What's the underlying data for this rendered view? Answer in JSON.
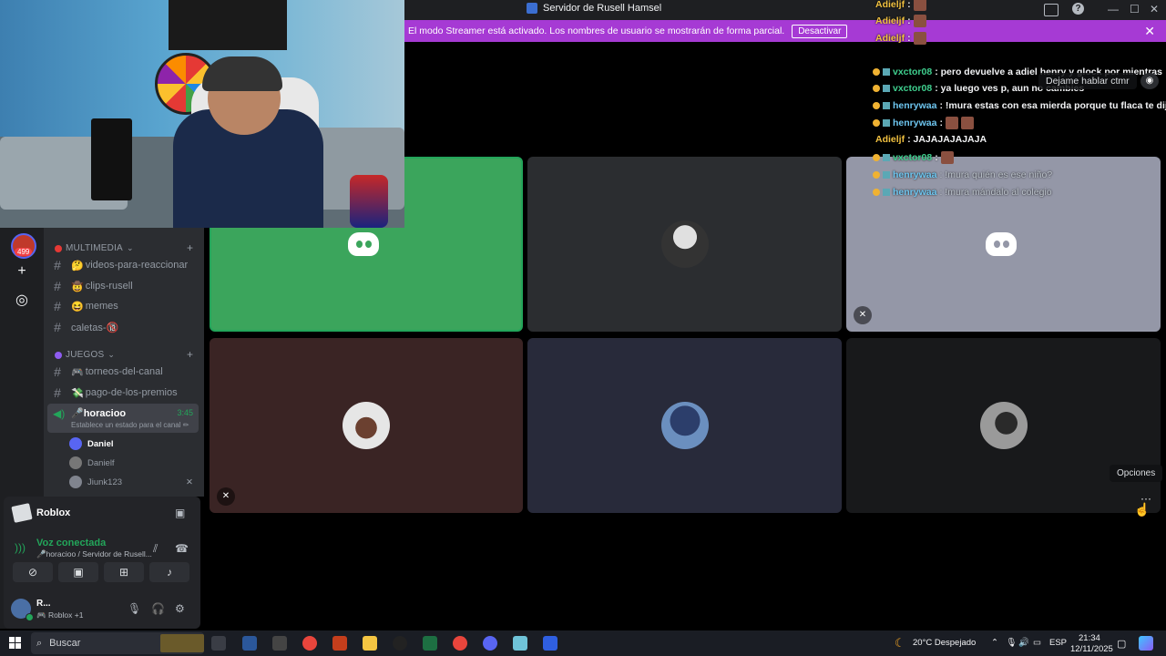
{
  "titlebar": {
    "title": "Servidor de Rusell Hamsel",
    "minimize": "—",
    "maximize": "☐",
    "close": "✕"
  },
  "banner": {
    "text": "El modo Streamer está activado. Los nombres de usuario se mostrarán de forma parcial.",
    "button": "Desactivar",
    "close": "✕"
  },
  "rail": {
    "badge": "499",
    "add": "+",
    "explore": "◎"
  },
  "channels": {
    "cat1": "MULTIMEDIA",
    "cat1_items": [
      {
        "emoji": "🤔",
        "name": "videos-para-reaccionar"
      },
      {
        "emoji": "🤠",
        "name": "clips-rusell"
      },
      {
        "emoji": "😆",
        "name": "memes"
      },
      {
        "emoji": "",
        "name": "caletas-🔞"
      }
    ],
    "cat2": "JUEGOS",
    "cat2_items": [
      {
        "emoji": "🎮",
        "name": "torneos-del-canal"
      },
      {
        "emoji": "💸",
        "name": "pago-de-los-premios"
      }
    ],
    "voice": {
      "name": "🎤horacioo",
      "time": "3:45",
      "status": "Establece un estado para el canal ✏"
    },
    "members": [
      "Daniel",
      "Danielf",
      "Jiunk123"
    ]
  },
  "panel": {
    "activity": "Roblox",
    "voice_status": "Voz conectada",
    "voice_sub": "🎤horacioo / Servidor de Rusell...",
    "user_name": "R...",
    "user_sub": "🎮 Roblox +1"
  },
  "chat": [
    {
      "user": "Adieljf",
      "text": ":",
      "color": "orange",
      "badges": false,
      "emote": true
    },
    {
      "user": "Adieljf",
      "text": ":",
      "color": "orange",
      "badges": false,
      "emote": true
    },
    {
      "user": "Adieljf",
      "text": ":",
      "color": "orange",
      "badges": false,
      "emote": true
    },
    {
      "user": "vxctor08",
      "text": ": pero devuelve a adiel henry y glock por mientras",
      "color": "green",
      "badges": true,
      "emote": false
    },
    {
      "user": "vxctor08",
      "text": ": ya luego ves p, aun no cambies",
      "color": "green",
      "badges": true,
      "emote": false
    },
    {
      "user": "henrywaa",
      "text": ": !mura estas con esa mierda porque tu flaca te dijo eso",
      "color": "blue",
      "badges": true,
      "emote": false
    },
    {
      "user": "henrywaa",
      "text": ":",
      "color": "blue",
      "badges": true,
      "emote": true
    },
    {
      "user": "Adieljf",
      "text": ": JAJAJAJAJAJA",
      "color": "orange",
      "badges": false,
      "emote": false
    },
    {
      "user": "vxctor08",
      "text": ":",
      "color": "green",
      "badges": true,
      "emote": true
    },
    {
      "user": "henrywaa",
      "text": ": !mura quién es ese niño?",
      "color": "blue",
      "badges": true,
      "emote": false
    },
    {
      "user": "henrywaa",
      "text": ": !mura mándalo al colegio",
      "color": "blue",
      "badges": true,
      "emote": false
    }
  ],
  "tooltips": {
    "overlay": "Dejame hablar ctmr",
    "options": "Opciones"
  },
  "options_btn": "···",
  "taskbar": {
    "search": "Buscar",
    "weather": "20°C  Despejado",
    "lang": "ESP",
    "time": "21:34",
    "date": "12/11/2025"
  },
  "colors": {
    "accent": "#5865f2",
    "banner": "#a63ad4",
    "speaking": "#3ba55c",
    "connected": "#23a55a"
  }
}
